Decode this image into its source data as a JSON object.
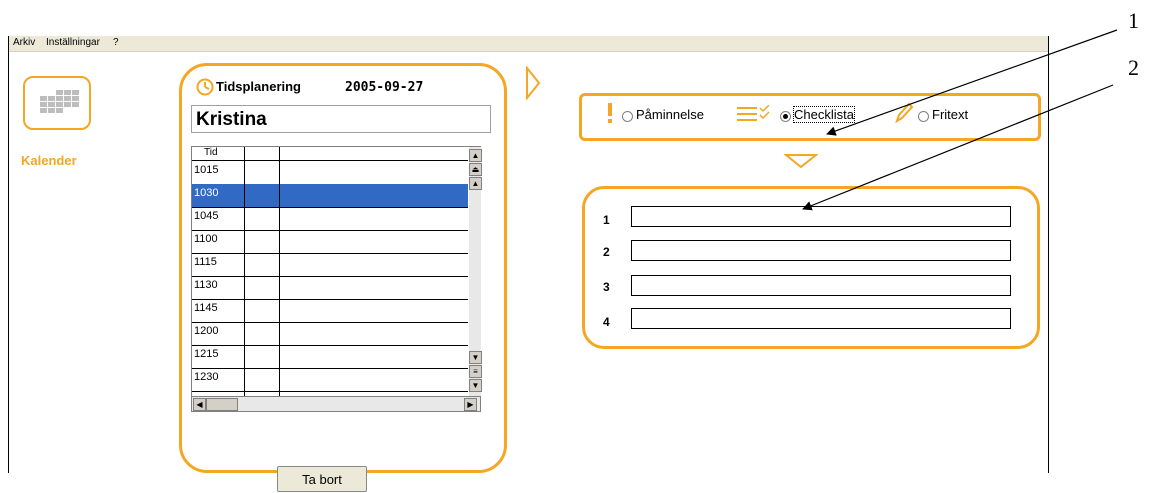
{
  "menu": [
    "Arkiv",
    "Inställningar",
    "?"
  ],
  "calendar": {
    "label": "Kalender",
    "accent": "#f5a623"
  },
  "planning": {
    "title": "Tidsplanering",
    "date": "2005-09-27",
    "name": "Kristina",
    "column_header": "Tid",
    "times": [
      "1015",
      "1030",
      "1045",
      "1100",
      "1115",
      "1130",
      "1145",
      "1200",
      "1215",
      "1230"
    ],
    "selected_index": 1,
    "delete_button": "Ta bort"
  },
  "modes": {
    "options": [
      "Påminnelse",
      "Checklista",
      "Fritext"
    ],
    "selected": "Checklista"
  },
  "checklist": {
    "numbers": [
      "1",
      "2",
      "3",
      "4"
    ],
    "values": [
      "",
      "",
      "",
      ""
    ]
  },
  "annotations": [
    "1",
    "2"
  ],
  "colors": {
    "accent": "#f5a623",
    "selection": "#316ac5"
  }
}
